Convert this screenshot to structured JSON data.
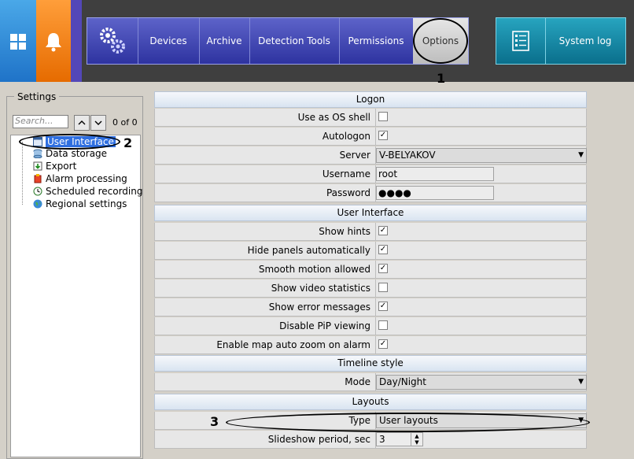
{
  "nav": {
    "devices": "Devices",
    "archive": "Archive",
    "detection_tools": "Detection Tools",
    "permissions": "Permissions",
    "options": "Options",
    "system_log": "System log"
  },
  "callouts": {
    "one": "1",
    "two": "2",
    "three": "3"
  },
  "left": {
    "settings_label": "Settings",
    "search_placeholder": "Search...",
    "counter": "0 of 0",
    "items": [
      {
        "label": "User Interface",
        "icon": "window-icon"
      },
      {
        "label": "Data storage",
        "icon": "database-gear-icon"
      },
      {
        "label": "Export",
        "icon": "export-arrow-icon"
      },
      {
        "label": "Alarm processing",
        "icon": "alarm-icon"
      },
      {
        "label": "Scheduled recording",
        "icon": "clock-icon"
      },
      {
        "label": "Regional settings",
        "icon": "globe-icon"
      }
    ]
  },
  "grid": {
    "logon": {
      "title": "Logon",
      "use_os_shell": {
        "label": "Use as OS shell",
        "checked": false
      },
      "autologon": {
        "label": "Autologon",
        "checked": true
      },
      "server": {
        "label": "Server",
        "value": "V-BELYAKOV"
      },
      "username": {
        "label": "Username",
        "value": "root"
      },
      "password": {
        "label": "Password",
        "value": "●●●●"
      }
    },
    "ui": {
      "title": "User Interface",
      "show_hints": {
        "label": "Show hints",
        "checked": true
      },
      "hide_panels": {
        "label": "Hide panels automatically",
        "checked": true
      },
      "smooth_motion": {
        "label": "Smooth motion allowed",
        "checked": true
      },
      "video_stats": {
        "label": "Show video statistics",
        "checked": false
      },
      "error_messages": {
        "label": "Show error messages",
        "checked": true
      },
      "disable_pip": {
        "label": "Disable PiP viewing",
        "checked": false
      },
      "map_zoom": {
        "label": "Enable map auto zoom on alarm",
        "checked": true
      }
    },
    "timeline": {
      "title": "Timeline style",
      "mode": {
        "label": "Mode",
        "value": "Day/Night"
      }
    },
    "layouts": {
      "title": "Layouts",
      "type": {
        "label": "Type",
        "value": "User layouts"
      },
      "slideshow": {
        "label": "Slideshow period, sec",
        "value": "3"
      }
    }
  }
}
